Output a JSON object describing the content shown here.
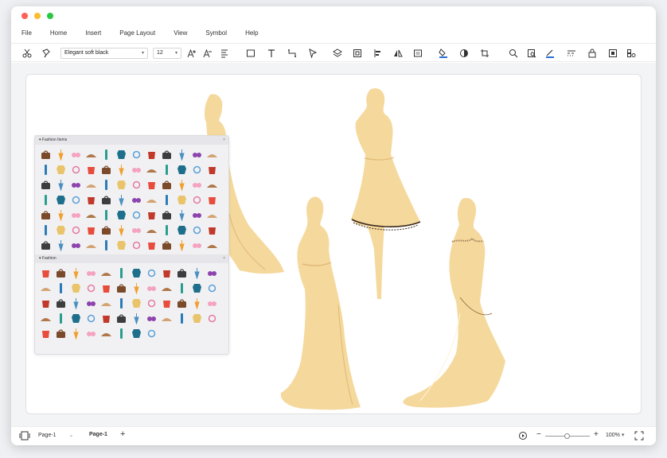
{
  "menu": [
    "File",
    "Home",
    "Insert",
    "Page Layout",
    "View",
    "Symbol",
    "Help"
  ],
  "toolbar": {
    "font_name": "Elegant soft black",
    "font_size": "12"
  },
  "panels": {
    "fashion_items_title": "Fashion Items",
    "fashion_title": "Fashion"
  },
  "status": {
    "page_dropdown": "Page-1",
    "active_tab": "Page-1",
    "add_page": "+",
    "zoom": "100%"
  },
  "colors": {
    "figure_fill": "#f5d89c",
    "accent_blue": "#2a6fd6"
  }
}
